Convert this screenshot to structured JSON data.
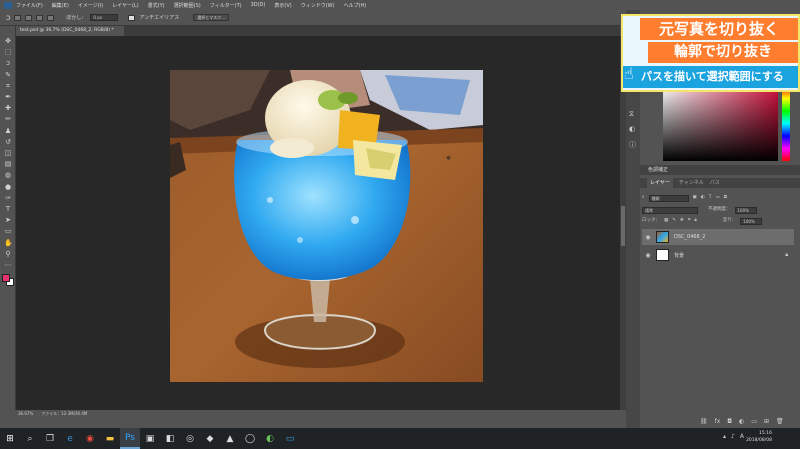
{
  "menu": {
    "items": [
      "ファイル(F)",
      "編集(E)",
      "イメージ(I)",
      "レイヤー(L)",
      "書式(Y)",
      "選択範囲(S)",
      "フィルター(T)",
      "3D(D)",
      "表示(V)",
      "ウィンドウ(W)",
      "ヘルプ(H)"
    ]
  },
  "options": {
    "feather_label": "ぼかし：",
    "feather_value": "0 px",
    "antialias_label": "アンチエイリアス",
    "select_mask_label": "選択とマスク..."
  },
  "document": {
    "tab_title": "test.psd @ 36.7% (DSC_0468_2, RGB/8) *"
  },
  "status": {
    "text": "36.67%　　ファイル：12.3M/30.4M"
  },
  "tools": [
    "move-tool",
    "marquee-tool",
    "lasso-tool",
    "quick-select-tool",
    "crop-tool",
    "eyedropper-tool",
    "healing-tool",
    "brush-tool",
    "stamp-tool",
    "history-brush-tool",
    "eraser-tool",
    "gradient-tool",
    "blur-tool",
    "dodge-tool",
    "pen-tool",
    "type-tool",
    "path-select-tool",
    "shape-tool",
    "hand-tool",
    "zoom-tool",
    "more-tools"
  ],
  "tool_glyphs": [
    "✥",
    "⬚",
    "ↄ",
    "✎",
    "⌗",
    "✒",
    "✚",
    "✏",
    "♟",
    "↺",
    "◫",
    "▤",
    "◍",
    "●",
    "✑",
    "T",
    "➤",
    "▭",
    "✋",
    "⚲",
    "⋯"
  ],
  "colors": {
    "foreground": "#e8326f",
    "background": "#ffffff",
    "picker_hue": "#d4123f"
  },
  "banner": {
    "line1": "元写真を切り抜く",
    "line2": "輪郭で切り抜き",
    "line3": "パスを描いて選択範囲にする"
  },
  "panels": {
    "properties_title": "色調補正",
    "layers_tabs": [
      "レイヤー",
      "チャンネル",
      "パス"
    ],
    "kind_label": "種類",
    "blend_mode": "通常",
    "opacity_label": "不透明度：",
    "opacity_value": "100%",
    "lock_label": "ロック：",
    "fill_label": "塗り：",
    "fill_value": "100%",
    "layers": [
      {
        "name": "DSC_0468_2",
        "visible": true,
        "selected": true
      },
      {
        "name": "背景",
        "visible": true,
        "selected": false
      }
    ]
  },
  "taskbar": {
    "time": "15:16",
    "date": "2018/08/08",
    "apps": [
      "start",
      "search",
      "task-view",
      "edge",
      "chrome",
      "explorer",
      "photoshop",
      "app7",
      "app8",
      "app9",
      "app10",
      "app11",
      "app12",
      "app13",
      "app14"
    ]
  }
}
